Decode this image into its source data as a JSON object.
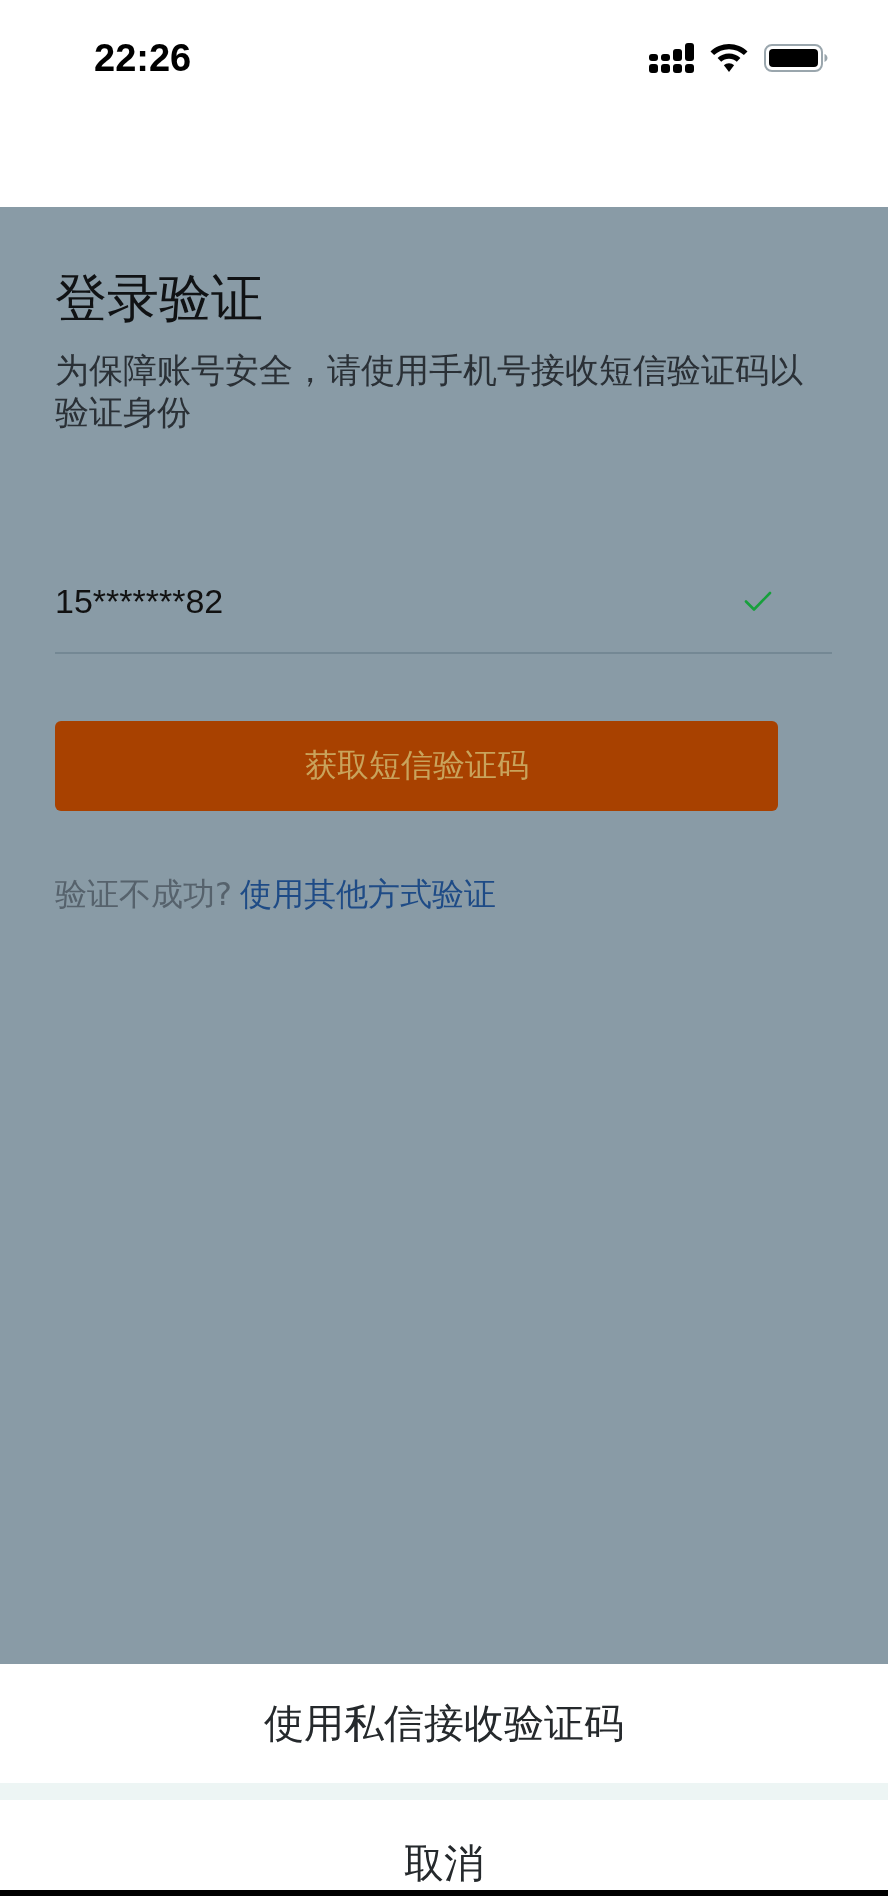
{
  "status_bar": {
    "time": "22:26"
  },
  "verification": {
    "title": "登录验证",
    "description": "为保障账号安全，请使用手机号接收短信验证码以验证身份",
    "phone_field": {
      "value": "15*******82",
      "valid": true
    },
    "submit_button": {
      "label": "获取短信验证码"
    },
    "help": {
      "text": "验证不成功?",
      "link": "使用其他方式验证"
    }
  },
  "action_sheet": {
    "options": [
      {
        "label": "使用私信接收验证码",
        "kind": "option"
      },
      {
        "label": "取消",
        "kind": "cancel"
      }
    ]
  }
}
